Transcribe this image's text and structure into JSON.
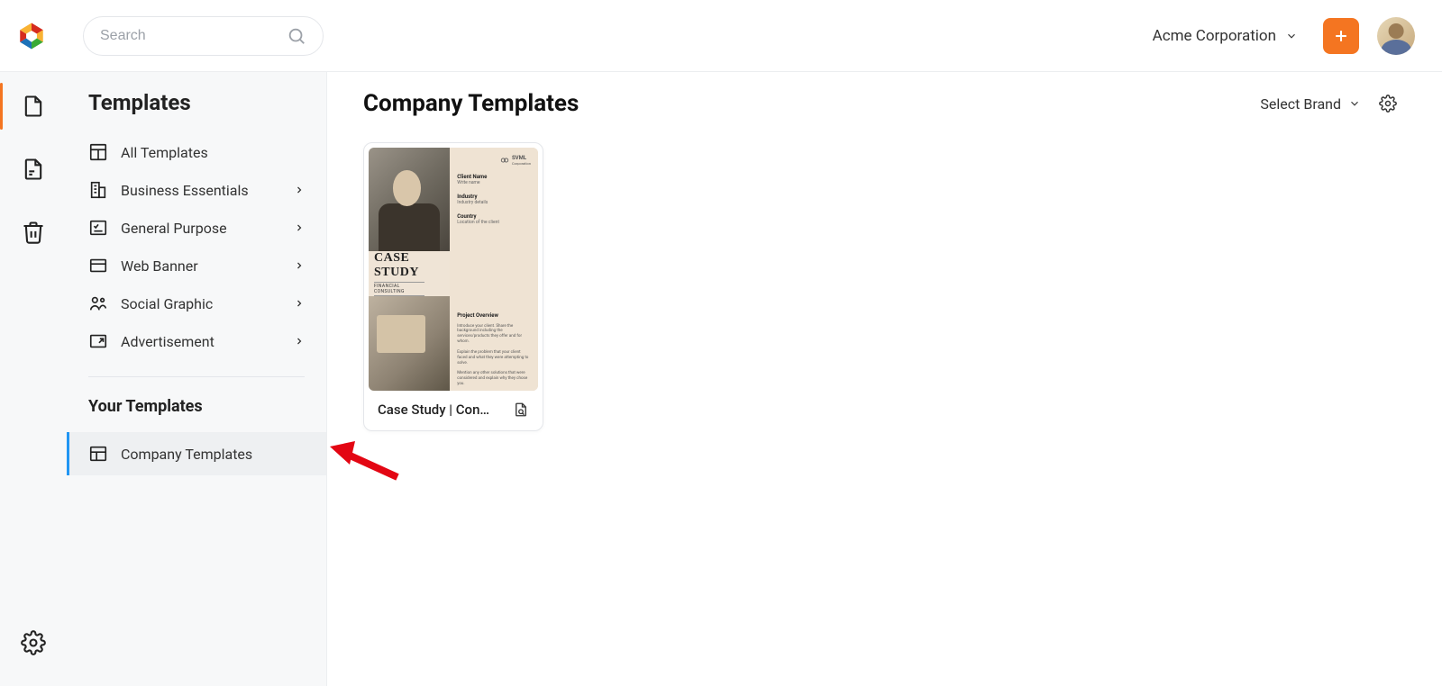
{
  "header": {
    "search_placeholder": "Search",
    "workspace_label": "Acme Corporation"
  },
  "sidebar": {
    "title": "Templates",
    "items": [
      {
        "label": "All Templates",
        "expandable": false
      },
      {
        "label": "Business Essentials",
        "expandable": true
      },
      {
        "label": "General Purpose",
        "expandable": true
      },
      {
        "label": "Web Banner",
        "expandable": true
      },
      {
        "label": "Social Graphic",
        "expandable": true
      },
      {
        "label": "Advertisement",
        "expandable": true
      }
    ],
    "your_templates_heading": "Your Templates",
    "company_templates_label": "Company Templates"
  },
  "main": {
    "heading": "Company Templates",
    "brand_selector_label": "Select Brand",
    "cards": [
      {
        "title": "Case Study | Con…",
        "thumb": {
          "brand": "SVML",
          "brand_sub": "Corporation",
          "field1_title": "Client Name",
          "field1_sub": "Write name",
          "field2_title": "Industry",
          "field2_sub": "Industry details",
          "field3_title": "Country",
          "field3_sub": "Location of the client",
          "case_study_title": "CASE STUDY",
          "case_study_sub": "FINANCIAL CONSULTING",
          "overview_title": "Project Overview",
          "overview_p1": "Introduce your client. Share the background including the services/products they offer and for whom.",
          "overview_p2": "Explain the problem that your client faced and what they were attempting to solve.",
          "overview_p3": "Mention any other solutions that were considered and explain why they chose you."
        }
      }
    ]
  }
}
